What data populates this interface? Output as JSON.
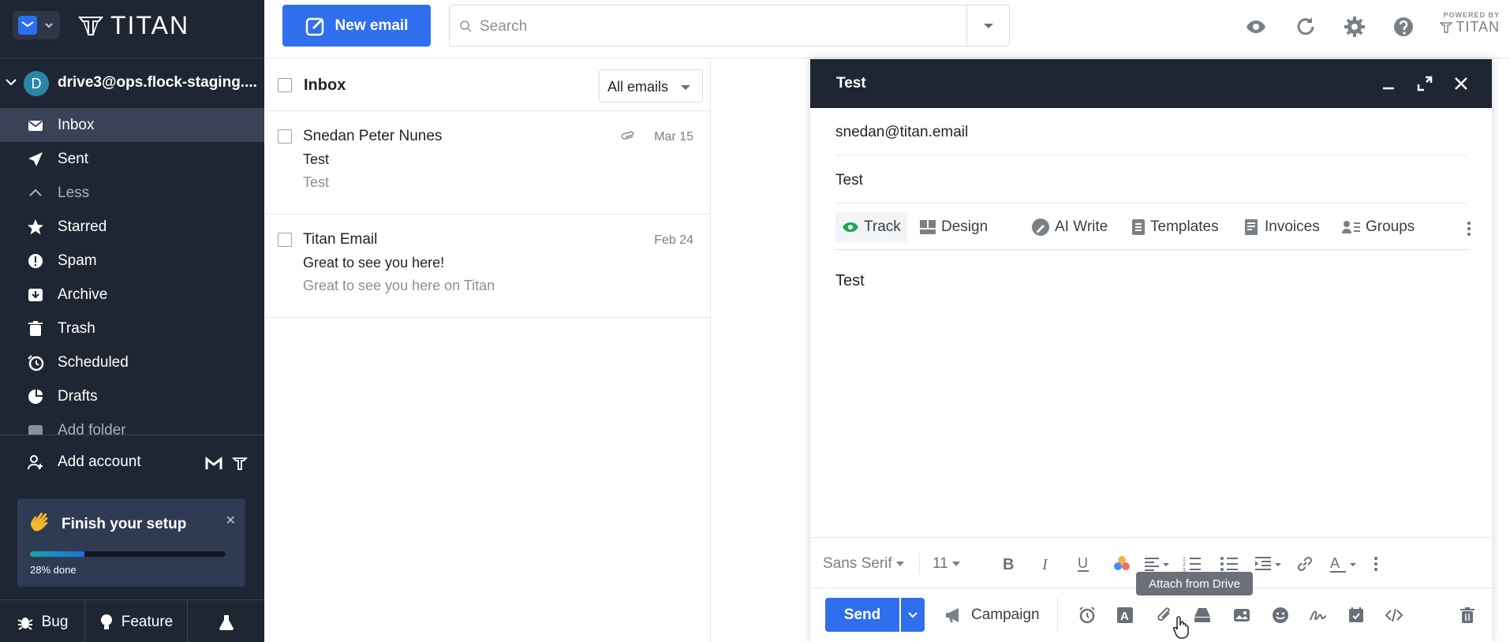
{
  "app": {
    "logo_text": "TITAN",
    "powered_by": "POWERED BY",
    "powered_brand": "TITAN"
  },
  "sidebar": {
    "account_initial": "D",
    "account_email": "drive3@ops.flock-staging....",
    "folders": [
      {
        "label": "Inbox",
        "icon": "inbox-icon",
        "active": true
      },
      {
        "label": "Sent",
        "icon": "send-icon"
      },
      {
        "label": "Less",
        "icon": "chevron-up-icon"
      },
      {
        "label": "Starred",
        "icon": "star-icon"
      },
      {
        "label": "Spam",
        "icon": "spam-icon"
      },
      {
        "label": "Archive",
        "icon": "archive-icon"
      },
      {
        "label": "Trash",
        "icon": "trash-icon"
      },
      {
        "label": "Scheduled",
        "icon": "clock-icon"
      },
      {
        "label": "Drafts",
        "icon": "drafts-icon"
      },
      {
        "label": "Add folder",
        "icon": "add-folder-icon"
      }
    ],
    "add_account": "Add account",
    "setup": {
      "title": "Finish your setup",
      "progress_percent": 28,
      "progress_label": "28% done"
    },
    "footer": {
      "bug": "Bug",
      "feature": "Feature"
    }
  },
  "header": {
    "new_email": "New email",
    "search_placeholder": "Search"
  },
  "list": {
    "title": "Inbox",
    "filter": "All emails",
    "emails": [
      {
        "from": "Snedan Peter Nunes",
        "subject": "Test",
        "preview": "Test",
        "date": "Mar 15",
        "attachment": true
      },
      {
        "from": "Titan Email",
        "subject": "Great to see you here!",
        "preview": "Great to see you here on Titan",
        "date": "Feb 24",
        "attachment": false
      }
    ]
  },
  "compose": {
    "title": "Test",
    "to": "snedan@titan.email",
    "subject": "Test",
    "tools": [
      "Track",
      "Design",
      "AI Write",
      "Templates",
      "Invoices",
      "Groups"
    ],
    "body": "Test",
    "font_family": "Sans Serif",
    "font_size": "11",
    "send": "Send",
    "campaign": "Campaign",
    "tooltip": "Attach from Drive"
  },
  "colors": {
    "sidebar_bg": "#1f2633",
    "accent": "#2f6fed"
  }
}
